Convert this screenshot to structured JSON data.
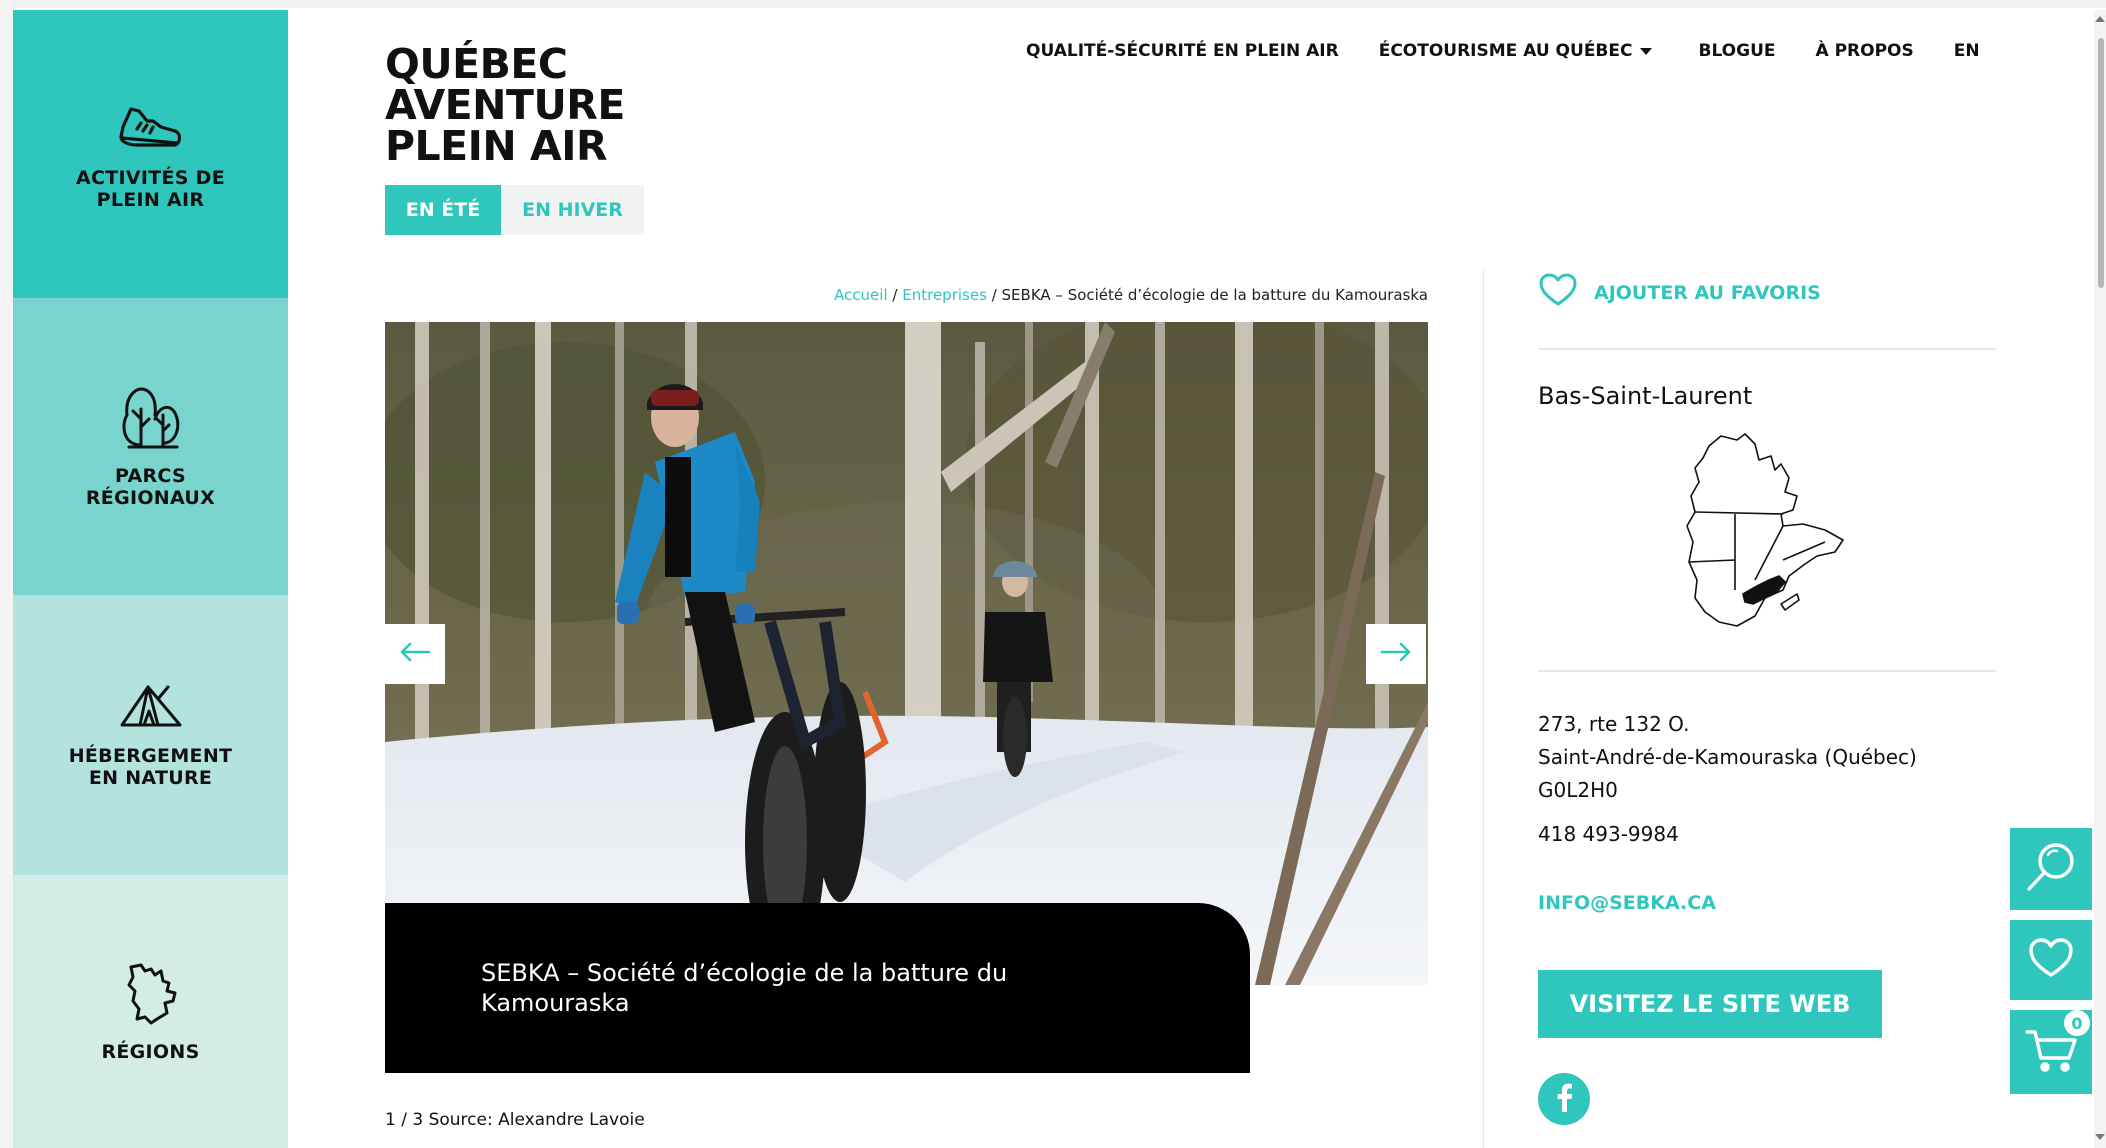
{
  "sidebar": {
    "items": [
      {
        "label": "ACTIVITÉS DE\nPLEIN AIR",
        "icon": "sneaker-icon"
      },
      {
        "label": "PARCS\nRÉGIONAUX",
        "icon": "trees-icon"
      },
      {
        "label": "HÉBERGEMENT\nEN NATURE",
        "icon": "tent-icon"
      },
      {
        "label": "RÉGIONS",
        "icon": "quebec-map-icon"
      }
    ]
  },
  "logo": {
    "line1": "QUÉBEC",
    "line2": "AVENTURE",
    "line3": "PLEIN AIR"
  },
  "season": {
    "summer": "EN ÉTÉ",
    "winter": "EN HIVER",
    "active": "summer"
  },
  "nav": {
    "items": [
      {
        "label": "QUALITÉ-SÉCURITÉ EN PLEIN AIR"
      },
      {
        "label": "ÉCOTOURISME AU QUÉBEC",
        "has_dropdown": true
      },
      {
        "label": "BLOGUE"
      },
      {
        "label": "À PROPOS"
      },
      {
        "label": "EN"
      }
    ]
  },
  "breadcrumb": {
    "home": "Accueil",
    "sep": "/",
    "section": "Entreprises",
    "current": "SEBKA – Société d’écologie de la batture du Kamouraska"
  },
  "slider": {
    "caption": "SEBKA – Société d’écologie de la batture du Kamouraska",
    "counter": "1 / 3 Source: Alexandre Lavoie"
  },
  "details": {
    "favorite_label": "AJOUTER AU FAVORIS",
    "region": "Bas-Saint-Laurent",
    "address_line1": "273, rte 132 O.",
    "address_line2": "Saint-André-de-Kamouraska (Québec)",
    "address_line3": "G0L2H0",
    "phone": "418 493-9984",
    "email": "INFO@SEBKA.CA",
    "website_button": "VISITEZ LE SITE WEB"
  },
  "floating": {
    "cart_count": "0"
  },
  "colors": {
    "accent": "#2fc6bd",
    "sidebar_2": "#78d4cc",
    "sidebar_3": "#b3e3dc",
    "sidebar_4": "#d3ece6"
  }
}
